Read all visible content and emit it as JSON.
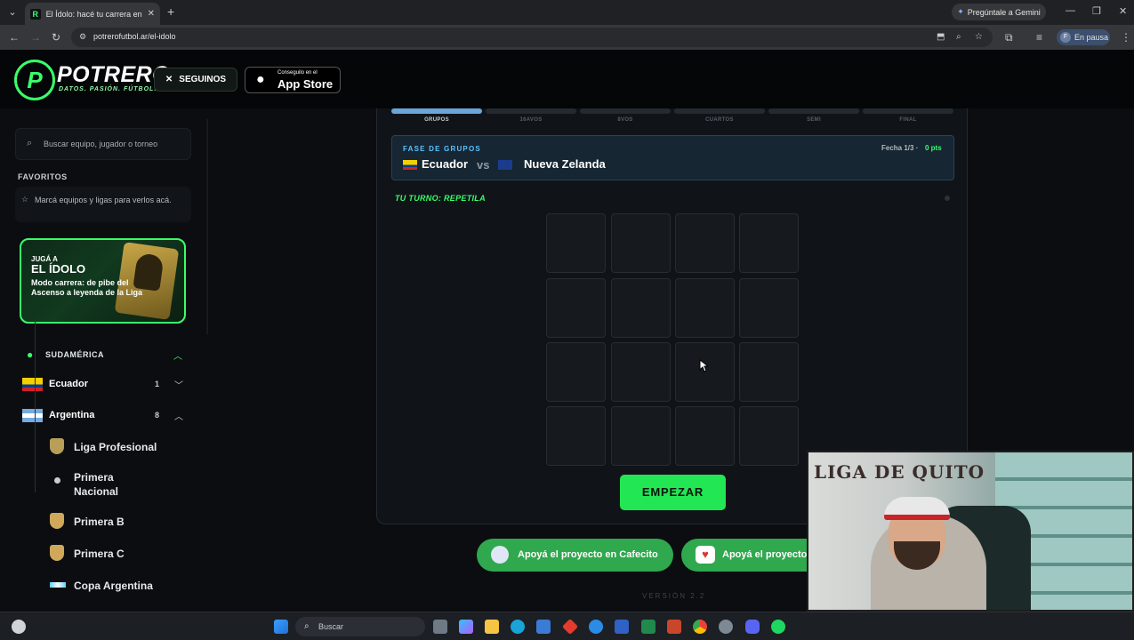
{
  "browser": {
    "tab_title": "El Ídolo: hacé tu carrera en la Li",
    "tab_favicon": "R",
    "gemini_label": "Pregúntale a Gemini",
    "url": "potrerofutbol.ar/el-idolo",
    "profile_initial": "F",
    "profile_status": "En pausa"
  },
  "header": {
    "logo_mark": "P",
    "logo_name": "POTRERO",
    "logo_tagline": "DATOS. PASIÓN. FÚTBOL.",
    "follow_label": "SEGUINOS",
    "follow_icon": "x-icon",
    "appstore_small": "Conseguilo en el",
    "appstore_big": "App Store"
  },
  "sidebar": {
    "search_placeholder": "Buscar equipo, jugador o torneo",
    "favorites_title": "FAVORITOS",
    "favorites_hint": "Marcá equipos y ligas para verlos acá.",
    "promo": {
      "kicker": "JUGÁ A",
      "title": "EL ÍDOLO",
      "description": "Modo carrera: de pibe del Ascenso a leyenda de la Liga"
    },
    "region": "SUDAMÉRICA",
    "countries": [
      {
        "name": "Ecuador",
        "count": "1"
      },
      {
        "name": "Argentina",
        "count": "8"
      }
    ],
    "leagues": [
      {
        "label": "Liga Profesional"
      },
      {
        "label": "Primera Nacional"
      },
      {
        "label": "Primera B"
      },
      {
        "label": "Primera C"
      },
      {
        "label": "Copa Argentina"
      }
    ]
  },
  "game": {
    "stages": [
      "GRUPOS",
      "16AVOS",
      "8VOS",
      "CUARTOS",
      "SEMI",
      "FINAL"
    ],
    "active_stage": "GRUPOS",
    "phase": "FASE DE GRUPOS",
    "home_team": "Ecuador",
    "vs": "vs",
    "away_team": "Nueva Zelanda",
    "fixture": "Fecha 1/3 ·",
    "points": "0 pts",
    "turn_label": "TU TURNO: REPETILA",
    "start_label": "EMPEZAR"
  },
  "footer": {
    "support_cafecito": "Apoyá el proyecto en Cafecito",
    "support_other": "Apoyá el proyecto",
    "version": "VERSIÓN 2.2"
  },
  "taskbar": {
    "search_placeholder": "Buscar"
  },
  "colors": {
    "brand_green": "#39ff6a",
    "button_green": "#22e653",
    "accent_blue": "#5cc2ff"
  }
}
